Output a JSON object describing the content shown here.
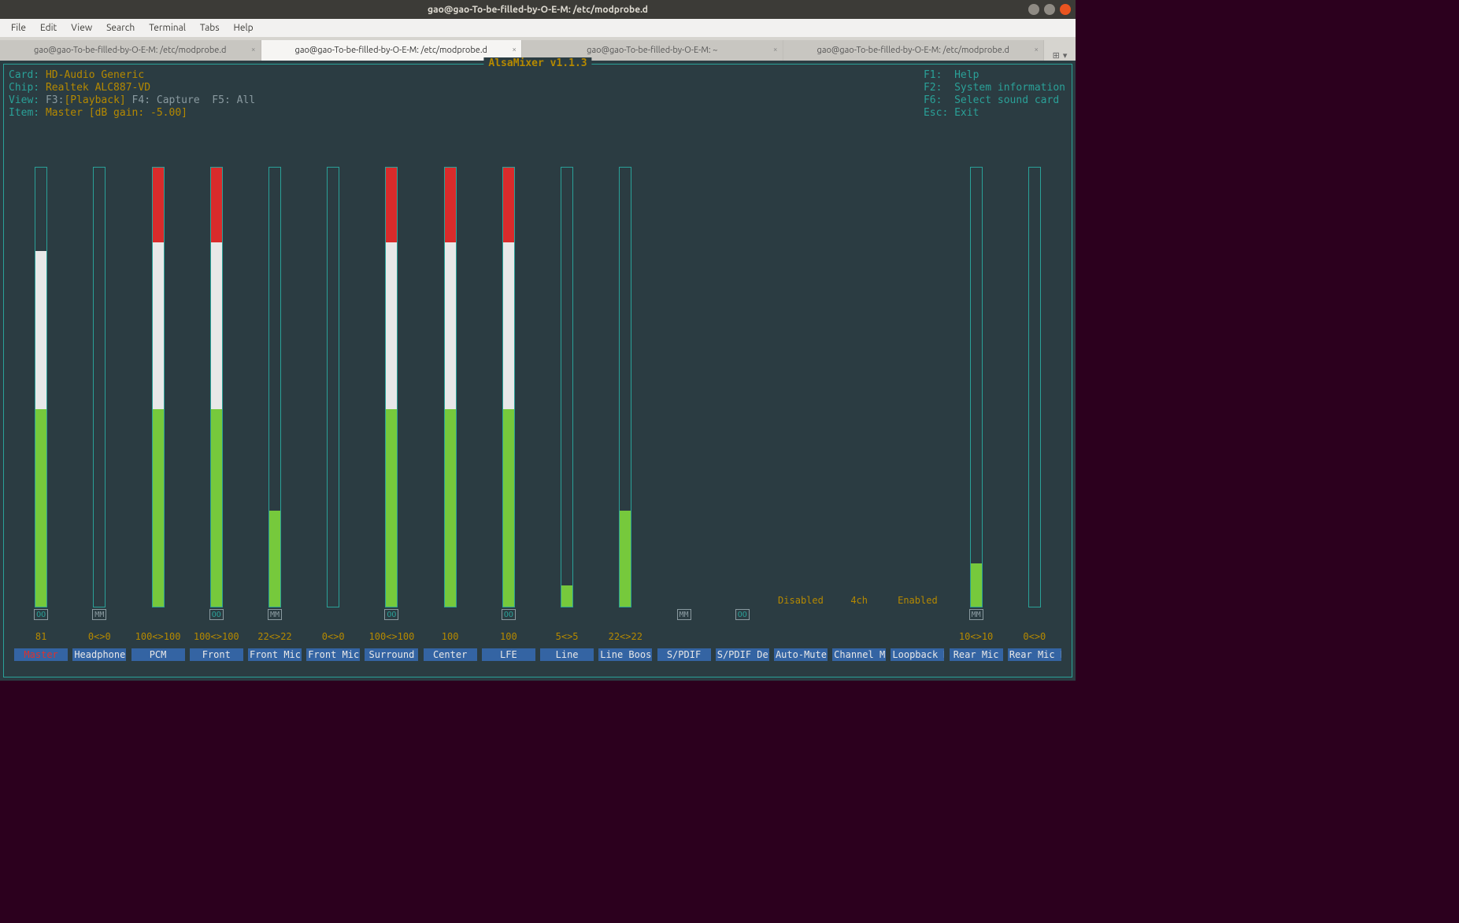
{
  "window": {
    "title": "gao@gao-To-be-filled-by-O-E-M: /etc/modprobe.d"
  },
  "menu": {
    "items": [
      "File",
      "Edit",
      "View",
      "Search",
      "Terminal",
      "Tabs",
      "Help"
    ]
  },
  "tabs": [
    {
      "label": "gao@gao-To-be-filled-by-O-E-M: /etc/modprobe.d",
      "active": false
    },
    {
      "label": "gao@gao-To-be-filled-by-O-E-M: /etc/modprobe.d",
      "active": true
    },
    {
      "label": "gao@gao-To-be-filled-by-O-E-M: ~",
      "active": false
    },
    {
      "label": "gao@gao-To-be-filled-by-O-E-M: /etc/modprobe.d",
      "active": false
    }
  ],
  "alsamixer": {
    "title": "AlsaMixer v1.1.3",
    "left": {
      "card_label": "Card: ",
      "card_value": "HD-Audio Generic",
      "chip_label": "Chip: ",
      "chip_value": "Realtek ALC887-VD",
      "view_label": "View: ",
      "view_f3": "F3:",
      "view_play": "[Playback]",
      "view_rest": " F4: Capture  F5: All",
      "item_label": "Item: ",
      "item_value": "Master [dB gain: -5.00]"
    },
    "right": {
      "l1a": "F1:",
      "l1b": "  Help",
      "l2a": "F2:",
      "l2b": "  System information",
      "l3a": "F6:",
      "l3b": "  Select sound card",
      "l4a": "Esc:",
      "l4b": " Exit"
    },
    "channels": [
      {
        "name": "Master",
        "value": "81",
        "level": 81,
        "mute": "OO",
        "selected": true,
        "bar": true,
        "full": false
      },
      {
        "name": "Headphone",
        "value": "0<>0",
        "level": 0,
        "mute": "MM",
        "bar": true,
        "full": false
      },
      {
        "name": "PCM",
        "value": "100<>100",
        "level": 100,
        "mute": null,
        "bar": true,
        "full": true
      },
      {
        "name": "Front",
        "value": "100<>100",
        "level": 100,
        "mute": "OO",
        "bar": true,
        "full": true
      },
      {
        "name": "Front Mic",
        "value": "22<>22",
        "level": 22,
        "mute": "MM",
        "bar": true,
        "full": false
      },
      {
        "name": "Front Mic",
        "value": "0<>0",
        "level": 0,
        "mute": null,
        "bar": true,
        "full": false
      },
      {
        "name": "Surround",
        "value": "100<>100",
        "level": 100,
        "mute": "OO",
        "bar": true,
        "full": true
      },
      {
        "name": "Center",
        "value": "100",
        "level": 100,
        "mute": null,
        "bar": true,
        "full": true
      },
      {
        "name": "LFE",
        "value": "100",
        "level": 100,
        "mute": "OO",
        "bar": true,
        "full": true
      },
      {
        "name": "Line",
        "value": "5<>5",
        "level": 5,
        "mute": null,
        "bar": true,
        "full": false
      },
      {
        "name": "Line Boost",
        "value": "22<>22",
        "level": 22,
        "mute": null,
        "bar": true,
        "full": false
      },
      {
        "name": "S/PDIF",
        "value": "",
        "level": 0,
        "mute": "MM",
        "bar": false,
        "full": false
      },
      {
        "name": "S/PDIF Def",
        "value": "",
        "level": 0,
        "mute": "OO",
        "bar": false,
        "full": false
      },
      {
        "name": "Auto-Mute",
        "value": "",
        "enum": "Disabled",
        "bar": false
      },
      {
        "name": "Channel Mo",
        "value": "",
        "enum": "4ch",
        "bar": false
      },
      {
        "name": "Loopback M",
        "value": "",
        "enum": "Enabled",
        "bar": false
      },
      {
        "name": "Rear Mic",
        "value": "10<>10",
        "level": 10,
        "mute": "MM",
        "bar": true,
        "full": false
      },
      {
        "name": "Rear Mic B",
        "value": "0<>0",
        "level": 0,
        "mute": null,
        "bar": true,
        "full": false
      }
    ]
  }
}
